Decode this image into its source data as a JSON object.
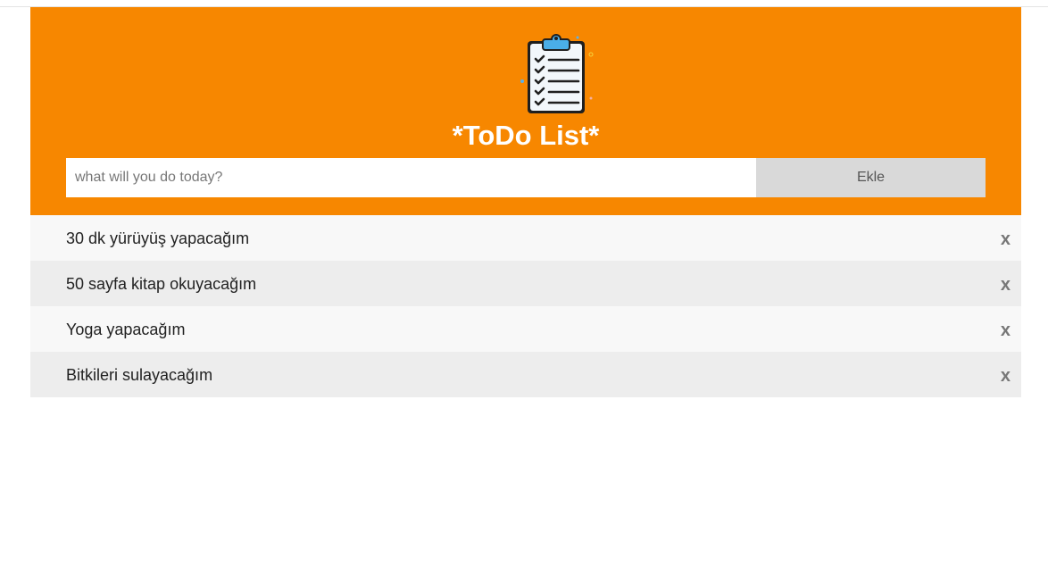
{
  "app": {
    "title": "*ToDo List*",
    "logo_icon": "clipboard-checklist-icon",
    "accent_color": "#f78700"
  },
  "add_form": {
    "placeholder": "what will you do today?",
    "value": "",
    "button_label": "Ekle"
  },
  "todos": [
    {
      "text": "30 dk yürüyüş yapacağım",
      "delete_label": "x"
    },
    {
      "text": "50 sayfa kitap okuyacağım",
      "delete_label": "x"
    },
    {
      "text": "Yoga yapacağım",
      "delete_label": "x"
    },
    {
      "text": "Bitkileri sulayacağım",
      "delete_label": "x"
    }
  ]
}
